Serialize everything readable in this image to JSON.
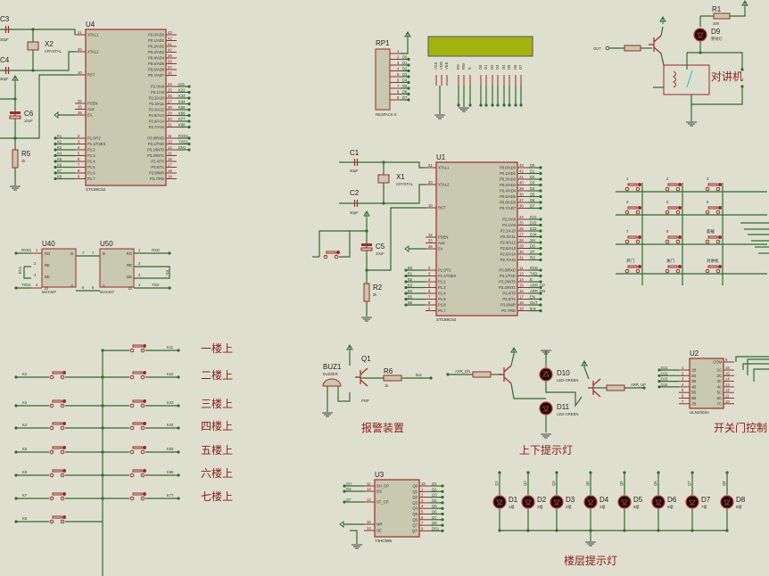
{
  "colors": {
    "background": "#dfdfcf",
    "wire": "#2f6b2f",
    "component": "#9e2a2a",
    "body": "#c9c8b0",
    "led": "#8b0000",
    "lcd": "#a3b411",
    "caption": "#8b1a1a"
  },
  "u4": {
    "ref": "U4",
    "part": "STC89C52",
    "left": [
      [
        "21",
        "XTAL1"
      ],
      [
        "20",
        "XTAL2"
      ],
      [
        "10",
        "RST"
      ],
      [
        "32",
        "PSEN"
      ],
      [
        "33",
        "ALE"
      ],
      [
        "35",
        "EA"
      ],
      [
        "2",
        "P1.0/T2"
      ],
      [
        "3",
        "P1.1/T2EX"
      ],
      [
        "4",
        "P1.2"
      ],
      [
        "5",
        "P1.3"
      ],
      [
        "6",
        "P1.4"
      ],
      [
        "7",
        "P1.5"
      ],
      [
        "8",
        "P1.6"
      ],
      [
        "9",
        "P1.7"
      ]
    ],
    "right": [
      [
        "43",
        "P0.0/AD0"
      ],
      [
        "42",
        "P0.1/AD1"
      ],
      [
        "41",
        "P0.2/AD2"
      ],
      [
        "40",
        "P0.3/AD3"
      ],
      [
        "39",
        "P0.4/AD4"
      ],
      [
        "38",
        "P0.5/AD5"
      ],
      [
        "37",
        "P0.6/AD6"
      ],
      [
        "36",
        "P0.7/AD7"
      ],
      [
        "24",
        "P2.0/A8"
      ],
      [
        "25",
        "P2.1/A9"
      ],
      [
        "26",
        "P2.2/A10"
      ],
      [
        "27",
        "P2.3/A11"
      ],
      [
        "28",
        "P2.4/A12"
      ],
      [
        "29",
        "P2.5/A13"
      ],
      [
        "30",
        "P2.6/A14"
      ],
      [
        "31",
        "P2.7/A15"
      ],
      [
        "11",
        "P3.0/RXD"
      ],
      [
        "13",
        "P3.1/TXD"
      ],
      [
        "14",
        "P3.2/INT0"
      ],
      [
        "15",
        "P3.3/INT1"
      ],
      [
        "16",
        "P3.4/T0"
      ],
      [
        "17",
        "P3.5/T1"
      ],
      [
        "18",
        "P3.6/WR"
      ],
      [
        "19",
        "P3.7/RD"
      ]
    ],
    "nets_left": [
      "",
      "",
      "",
      "",
      "",
      "",
      "K1",
      "K2",
      "K3",
      "K4",
      "K5",
      "K6",
      "K7",
      "K8"
    ],
    "nets_right": [
      "",
      "",
      "",
      "",
      "",
      "",
      "",
      "",
      "K11",
      "K22",
      "K33",
      "K44",
      "K55",
      "K66",
      "K77",
      "K88",
      "RXD1",
      "TXD1",
      "EN1",
      "",
      "",
      "",
      "",
      ""
    ]
  },
  "u4_parts": {
    "c3": "C3",
    "c3_val": "30pF",
    "c4": "C4",
    "c4_val": "30pF",
    "x2": "X2",
    "x2_val": "CRYSTAL",
    "c6": "C6",
    "c6_val": "10uF",
    "r5": "R5",
    "r5_val": "2k"
  },
  "u1": {
    "ref": "U1",
    "part": "STC89C52",
    "left": [
      [
        "21",
        "XTAL1"
      ],
      [
        "20",
        "XTAL2"
      ],
      [
        "10",
        "RST"
      ],
      [
        "32",
        "PSEN"
      ],
      [
        "33",
        "ALE"
      ],
      [
        "35",
        "EA"
      ],
      [
        "2",
        "P1.0/T2"
      ],
      [
        "3",
        "P1.1/T2EX"
      ],
      [
        "4",
        "P1.2"
      ],
      [
        "5",
        "P1.3"
      ],
      [
        "6",
        "P1.4"
      ],
      [
        "7",
        "P1.5"
      ],
      [
        "8",
        "P1.6"
      ],
      [
        "9",
        "P1.7"
      ]
    ],
    "right": [
      [
        "43",
        "P0.0/AD0"
      ],
      [
        "42",
        "P0.1/AD1"
      ],
      [
        "41",
        "P0.2/AD2"
      ],
      [
        "40",
        "P0.3/AD3"
      ],
      [
        "39",
        "P0.4/AD4"
      ],
      [
        "38",
        "P0.5/AD5"
      ],
      [
        "37",
        "P0.6/AD6"
      ],
      [
        "36",
        "P0.7/AD7"
      ],
      [
        "24",
        "P2.0/A8"
      ],
      [
        "25",
        "P2.1/A9"
      ],
      [
        "26",
        "P2.2/A10"
      ],
      [
        "27",
        "P2.3/A11"
      ],
      [
        "28",
        "P2.4/A12"
      ],
      [
        "29",
        "P2.5/A13"
      ],
      [
        "30",
        "P2.6/A14"
      ],
      [
        "31",
        "P2.7/A15"
      ],
      [
        "11",
        "P3.0/RXD"
      ],
      [
        "13",
        "P3.1/TXD"
      ],
      [
        "14",
        "P3.2/INT0"
      ],
      [
        "15",
        "P3.3/INT1"
      ],
      [
        "16",
        "P3.4/T0"
      ],
      [
        "17",
        "P3.5/T1"
      ],
      [
        "18",
        "P3.6/WR"
      ],
      [
        "19",
        "P3.7/RD"
      ]
    ],
    "nets_left": [
      "",
      "",
      "",
      "",
      "",
      "",
      "B0",
      "B1",
      "B2",
      "B3",
      "B4",
      "B5",
      "B6",
      ""
    ],
    "nets_right": [
      "D0",
      "D1",
      "D2",
      "D3",
      "D4",
      "D5",
      "D6",
      "D7",
      "DJ1",
      "DJ2",
      "DJ3",
      "DJ4",
      "SH",
      "DS",
      "ST",
      "RS",
      "RXD",
      "TXD",
      "E",
      "ARR_UP",
      "ARR_DN",
      "EN",
      "OUT",
      "buz"
    ]
  },
  "u1_parts": {
    "c1": "C1",
    "c1_val": "30pF",
    "c2": "C2",
    "c2_val": "30pF",
    "x1": "X1",
    "x1_val": "CRYSTAL",
    "c5": "C5",
    "c5_val": "10uF",
    "r2": "R2",
    "r2_val": "2k"
  },
  "max487": {
    "u40": "U40",
    "u50": "U50",
    "part": "MAX487",
    "pins_left": [
      "RO",
      "RE",
      "DE",
      "DI"
    ],
    "pins_right": [
      "B",
      "A"
    ],
    "u40_nums": [
      "",
      "2",
      "3",
      ""
    ],
    "bus_nums": [
      "7",
      "7",
      "6",
      "6"
    ],
    "u50_nums": [
      "1",
      "2",
      "3",
      "4"
    ],
    "u40_nets": [
      "RXD1",
      "TXD1"
    ],
    "u40_net_nums": [
      "1",
      "4"
    ],
    "u40_en": "EN1",
    "u50_nets": [
      "RXD",
      "TXD"
    ],
    "u50_en": "EN"
  },
  "rp1": {
    "ref": "RP1",
    "part": "RESPACK-8",
    "pins": [
      "1",
      "2",
      "3",
      "4",
      "5",
      "6",
      "7",
      "8",
      "9"
    ],
    "nets": [
      "D0",
      "D1",
      "D2",
      "D3",
      "D4",
      "D5",
      "D6",
      "D7"
    ]
  },
  "lcd": {
    "pins": [
      "VSS",
      "VDD",
      "VEE",
      "RS",
      "RW",
      "E",
      "D0",
      "D1",
      "D2",
      "D3",
      "D4",
      "D5",
      "D6",
      "D7"
    ],
    "nets_bottom": [
      "RS",
      "",
      "E",
      "D0",
      "D1",
      "D2",
      "D3",
      "D4",
      "D5",
      "D6",
      "D7"
    ]
  },
  "relay": {
    "r1": "R1",
    "r1_val": "300",
    "d9": "D9",
    "d9_val": "警特灯",
    "out": "OUT",
    "caption": "对讲机"
  },
  "keypad": {
    "labels": [
      "1",
      "2",
      "3",
      "4",
      "5",
      "6",
      "7",
      "8",
      "超载",
      "开门",
      "关门",
      "对讲机"
    ]
  },
  "floor_buttons": {
    "left_nets": [
      "K2",
      "K3",
      "K4",
      "K5",
      "K6",
      "K7",
      "K8"
    ],
    "right_nets": [
      "K11",
      "K22",
      "K33",
      "K44",
      "K55",
      "K66",
      "K77"
    ],
    "captions": [
      "一楼上",
      "二楼上",
      "三楼上",
      "四楼上",
      "五楼上",
      "六楼上",
      "七楼上"
    ]
  },
  "alarm": {
    "buz": "BUZ1",
    "buz_val": "BUZZER",
    "q": "Q1",
    "q_val": "PNP",
    "r": "R6",
    "r_val": "1k",
    "net": "buz",
    "caption": "报警装置"
  },
  "arrows": {
    "net_dn": "ARR_DN",
    "net_up": "ARR_UP",
    "d10": "D10",
    "d10_val": "LED-GREEN",
    "d11": "D11",
    "d11_val": "LED-GREEN",
    "caption": "上下提示灯"
  },
  "u2": {
    "ref": "U2",
    "part": "ULN2003A",
    "left": [
      [
        "1",
        "1B"
      ],
      [
        "2",
        "2B"
      ],
      [
        "3",
        "3B"
      ],
      [
        "4",
        "4B"
      ],
      [
        "5",
        "5B"
      ],
      [
        "6",
        "6B"
      ],
      [
        "7",
        "7B"
      ]
    ],
    "right": [
      [
        "9",
        "COM"
      ],
      [
        "16",
        "1C"
      ],
      [
        "15",
        "2C"
      ],
      [
        "14",
        "3C"
      ],
      [
        "13",
        "4C"
      ],
      [
        "12",
        "5C"
      ],
      [
        "11",
        "6C"
      ],
      [
        "10",
        "7C"
      ]
    ],
    "nets_left": [
      "DJ1",
      "DJ2",
      "DJ3",
      "DJ4",
      "",
      "",
      ""
    ],
    "caption": "开关门控制"
  },
  "u3": {
    "ref": "U3",
    "part": "74HC595",
    "left": [
      [
        "11",
        "SH_CP"
      ],
      [
        "14",
        "DS"
      ],
      [
        "12",
        "ST_CP"
      ],
      [
        "10",
        "MR"
      ],
      [
        "13",
        "OE"
      ]
    ],
    "right": [
      [
        "15",
        "Q0"
      ],
      [
        "1",
        "Q1"
      ],
      [
        "2",
        "Q2"
      ],
      [
        "3",
        "Q3"
      ],
      [
        "4",
        "Q4"
      ],
      [
        "5",
        "Q5"
      ],
      [
        "6",
        "Q6"
      ],
      [
        "7",
        "Q7"
      ],
      [
        "9",
        "Q7'"
      ]
    ],
    "nets_left": [
      "SH",
      "DS",
      "ST",
      "",
      ""
    ],
    "nets_right": [
      "Q1",
      "Q2",
      "Q3",
      "Q4",
      "Q5",
      "Q6",
      "Q7",
      "Q8",
      "DS1"
    ]
  },
  "floor_leds": {
    "refs": [
      "D1",
      "D2",
      "D3",
      "D4",
      "D5",
      "D6",
      "D7",
      "D8"
    ],
    "vals": [
      "1楼",
      "2楼",
      "3楼",
      "4楼",
      "5楼",
      "6楼",
      "7楼",
      "8楼"
    ],
    "nets": [
      "Q1",
      "Q2",
      "Q3",
      "Q4",
      "Q5",
      "Q6",
      "Q7",
      "Q8"
    ],
    "caption": "楼层提示灯"
  }
}
